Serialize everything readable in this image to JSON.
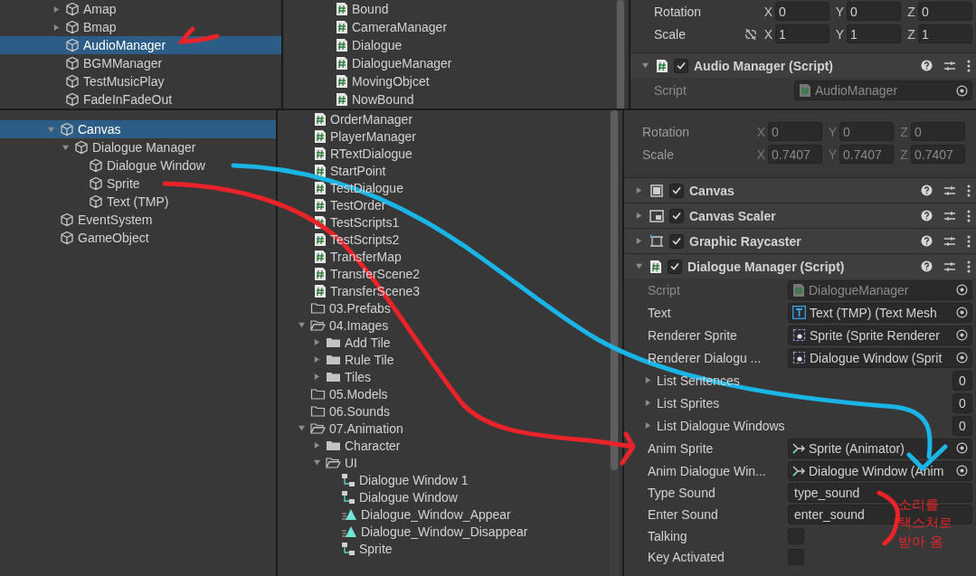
{
  "hierarchy_top": {
    "items": [
      {
        "label": "Amap",
        "selected": false,
        "expanded": false
      },
      {
        "label": "Bmap",
        "selected": false,
        "expanded": false
      },
      {
        "label": "AudioManager",
        "selected": true
      },
      {
        "label": "BGMManager",
        "selected": false
      },
      {
        "label": "TestMusicPlay",
        "selected": false
      },
      {
        "label": "FadeInFadeOut",
        "selected": false
      }
    ]
  },
  "project_top": {
    "scripts": [
      "Bound",
      "CameraManager",
      "Dialogue",
      "DialogueManager",
      "MovingObjcet",
      "NowBound"
    ]
  },
  "inspector_top": {
    "transform": [
      {
        "label": "Rotation",
        "fields": [
          {
            "axis": "X",
            "value": "0"
          },
          {
            "axis": "Y",
            "value": "0"
          },
          {
            "axis": "Z",
            "value": "0"
          }
        ]
      },
      {
        "label": "Scale",
        "linked": false,
        "fields": [
          {
            "axis": "X",
            "value": "1"
          },
          {
            "axis": "Y",
            "value": "1"
          },
          {
            "axis": "Z",
            "value": "1"
          }
        ]
      }
    ],
    "component": {
      "kind": "script",
      "title": "Audio Manager (Script)",
      "enabled": true,
      "expanded": true
    },
    "script": {
      "label": "Script",
      "value": "AudioManager"
    }
  },
  "hierarchy_bottom": {
    "items": [
      {
        "label": "Canvas",
        "selected": true,
        "expanded": true,
        "children": [
          {
            "label": "Dialogue Manager",
            "selected": false,
            "expanded": true,
            "children": [
              {
                "label": "Dialogue Window",
                "selected": false
              },
              {
                "label": "Sprite",
                "selected": false
              },
              {
                "label": "Text (TMP)",
                "selected": false
              }
            ]
          }
        ]
      },
      {
        "label": "EventSystem",
        "selected": false
      },
      {
        "label": "GameObject",
        "selected": false
      }
    ]
  },
  "project_bottom": {
    "scripts": [
      "OrderManager",
      "PlayerManager",
      "RTextDialogue",
      "StartPoint",
      "TestDialogue",
      "TestOrder",
      "TestScripts1",
      "TestScripts2",
      "TransferMap",
      "TransferScene2",
      "TransferScene3"
    ],
    "folders": [
      {
        "kind": "empty_folder",
        "label": "03.Prefabs"
      },
      {
        "kind": "folder",
        "label": "04.Images",
        "expanded": true,
        "children": [
          {
            "kind": "folder",
            "label": "Add Tile",
            "expanded": false
          },
          {
            "kind": "folder",
            "label": "Rule Tile",
            "expanded": false
          },
          {
            "kind": "folder",
            "label": "Tiles",
            "expanded": false
          }
        ]
      },
      {
        "kind": "empty_folder",
        "label": "05.Models"
      },
      {
        "kind": "empty_folder",
        "label": "06.Sounds"
      },
      {
        "kind": "folder",
        "label": "07.Animation",
        "expanded": true,
        "children": [
          {
            "kind": "folder",
            "label": "Character",
            "expanded": false
          },
          {
            "kind": "folder",
            "label": "UI",
            "expanded": true,
            "children": [
              {
                "kind": "controller",
                "label": "Dialogue Window 1"
              },
              {
                "kind": "controller",
                "label": "Dialogue Window"
              },
              {
                "kind": "clip",
                "label": "Dialogue_Window_Appear"
              },
              {
                "kind": "clip",
                "label": "Dialogue_Window_Disappear"
              },
              {
                "kind": "controller",
                "label": "Sprite"
              }
            ]
          }
        ]
      }
    ]
  },
  "inspector_bottom": {
    "transform_disabled": true,
    "transform": [
      {
        "label": "Rotation",
        "fields": [
          {
            "axis": "X",
            "value": "0"
          },
          {
            "axis": "Y",
            "value": "0"
          },
          {
            "axis": "Z",
            "value": "0"
          }
        ]
      },
      {
        "label": "Scale",
        "fields": [
          {
            "axis": "X",
            "value": "0.7407"
          },
          {
            "axis": "Y",
            "value": "0.7407"
          },
          {
            "axis": "Z",
            "value": "0.7407"
          }
        ]
      }
    ],
    "components": [
      {
        "kind": "canvas",
        "title": "Canvas",
        "enabled": true,
        "expanded": false
      },
      {
        "kind": "scaler",
        "title": "Canvas Scaler",
        "enabled": true,
        "expanded": false
      },
      {
        "kind": "raycaster",
        "title": "Graphic Raycaster",
        "enabled": true,
        "expanded": false
      },
      {
        "kind": "script",
        "title": "Dialogue Manager (Script)",
        "enabled": true,
        "expanded": true
      }
    ],
    "properties": [
      {
        "kind": "script_ref",
        "label": "Script",
        "value": "DialogueManager",
        "disabled": true
      },
      {
        "kind": "text_ref",
        "label": "Text",
        "value": "Text (TMP) (Text Mesh",
        "disabled": false
      },
      {
        "kind": "sprite_ref",
        "label": "Renderer Sprite",
        "value": "Sprite (Sprite Renderer",
        "disabled": false
      },
      {
        "kind": "sprite_ref",
        "label": "Renderer Dialogu ...",
        "value": "Dialogue Window (Sprit",
        "disabled": false
      },
      {
        "kind": "list",
        "label": "List Sentences",
        "value": "0",
        "expanded": false
      },
      {
        "kind": "list",
        "label": "List Sprites",
        "value": "0",
        "expanded": false
      },
      {
        "kind": "list",
        "label": "List Dialogue Windows",
        "value": "0",
        "expanded": false
      },
      {
        "kind": "animator_ref",
        "label": "Anim Sprite",
        "value": "Sprite (Animator)",
        "disabled": false
      },
      {
        "kind": "animator_ref",
        "label": "Anim Dialogue Win...",
        "value": "Dialogue Window (Anim",
        "disabled": false
      },
      {
        "kind": "text",
        "label": "Type Sound",
        "value": "type_sound"
      },
      {
        "kind": "text",
        "label": "Enter Sound",
        "value": "enter_sound"
      },
      {
        "kind": "bool",
        "label": "Talking",
        "checked": false
      },
      {
        "kind": "bool",
        "label": "Key Activated",
        "checked": false
      }
    ]
  },
  "annotation": {
    "note": "소리를\n택스처로\n받아 옴"
  }
}
